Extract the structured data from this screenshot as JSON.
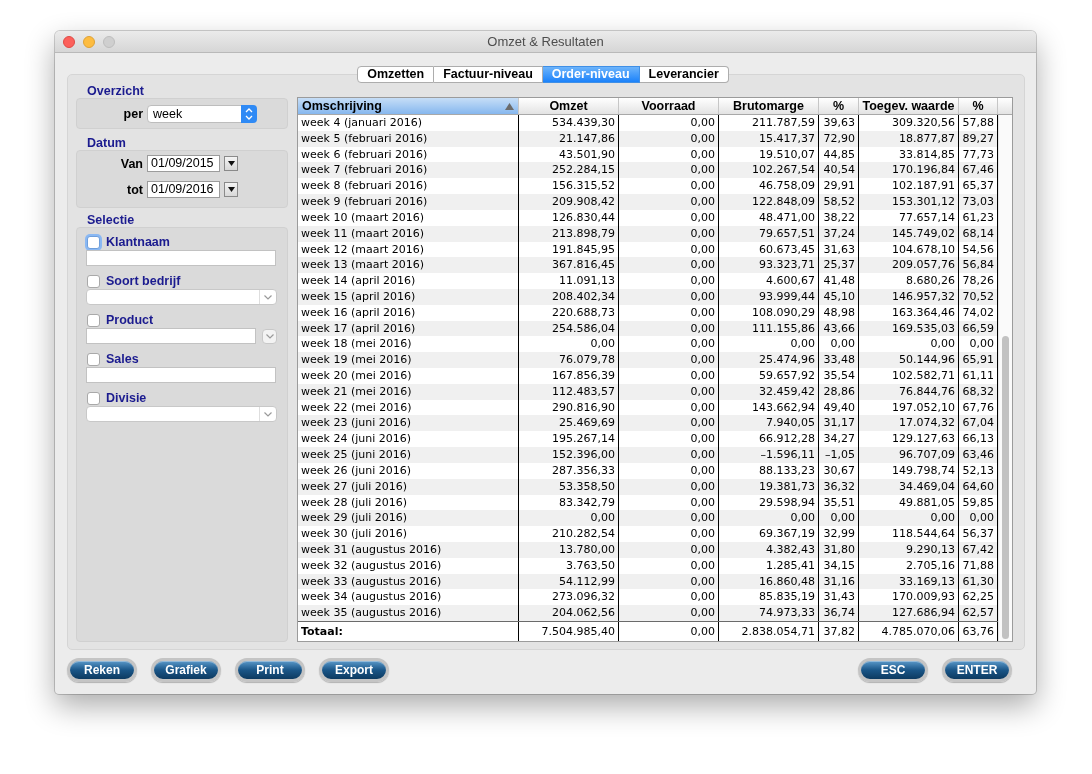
{
  "window": {
    "title": "Omzet & Resultaten"
  },
  "tabs": [
    {
      "label": "Omzetten",
      "selected": false
    },
    {
      "label": "Factuur-niveau",
      "selected": false
    },
    {
      "label": "Order-niveau",
      "selected": true
    },
    {
      "label": "Leverancier",
      "selected": false
    }
  ],
  "overzicht": {
    "title": "Overzicht",
    "per_label": "per",
    "per_value": "week"
  },
  "datum": {
    "title": "Datum",
    "fields": [
      {
        "label": "Van",
        "value": "01/09/2015"
      },
      {
        "label": "tot",
        "value": "01/09/2016"
      }
    ]
  },
  "selectie": {
    "title": "Selectie",
    "filters": [
      {
        "label": "Klantnaam",
        "kind": "text",
        "checked": false,
        "focused": true
      },
      {
        "label": "Soort bedrijf",
        "kind": "combo",
        "checked": false,
        "focused": false
      },
      {
        "label": "Product",
        "kind": "combo-split",
        "checked": false,
        "focused": false
      },
      {
        "label": "Sales",
        "kind": "text",
        "checked": false,
        "focused": false
      },
      {
        "label": "Divisie",
        "kind": "combo",
        "checked": false,
        "focused": false
      }
    ]
  },
  "table": {
    "columns": [
      {
        "label": "Omschrijving",
        "selected": true
      },
      {
        "label": "Omzet",
        "selected": false
      },
      {
        "label": "Voorraad",
        "selected": false
      },
      {
        "label": "Brutomarge",
        "selected": false
      },
      {
        "label": "%",
        "selected": false
      },
      {
        "label": "Toegev. waarde",
        "selected": false
      },
      {
        "label": "%",
        "selected": false
      }
    ],
    "rows": [
      [
        "week 4 (januari 2016)",
        "534.439,30",
        "0,00",
        "211.787,59",
        "39,63",
        "309.320,56",
        "57,88"
      ],
      [
        "week 5 (februari 2016)",
        "21.147,86",
        "0,00",
        "15.417,37",
        "72,90",
        "18.877,87",
        "89,27"
      ],
      [
        "week 6 (februari 2016)",
        "43.501,90",
        "0,00",
        "19.510,07",
        "44,85",
        "33.814,85",
        "77,73"
      ],
      [
        "week 7 (februari 2016)",
        "252.284,15",
        "0,00",
        "102.267,54",
        "40,54",
        "170.196,84",
        "67,46"
      ],
      [
        "week 8 (februari 2016)",
        "156.315,52",
        "0,00",
        "46.758,09",
        "29,91",
        "102.187,91",
        "65,37"
      ],
      [
        "week 9 (februari 2016)",
        "209.908,42",
        "0,00",
        "122.848,09",
        "58,52",
        "153.301,12",
        "73,03"
      ],
      [
        "week 10 (maart 2016)",
        "126.830,44",
        "0,00",
        "48.471,00",
        "38,22",
        "77.657,14",
        "61,23"
      ],
      [
        "week 11 (maart 2016)",
        "213.898,79",
        "0,00",
        "79.657,51",
        "37,24",
        "145.749,02",
        "68,14"
      ],
      [
        "week 12 (maart 2016)",
        "191.845,95",
        "0,00",
        "60.673,45",
        "31,63",
        "104.678,10",
        "54,56"
      ],
      [
        "week 13 (maart 2016)",
        "367.816,45",
        "0,00",
        "93.323,71",
        "25,37",
        "209.057,76",
        "56,84"
      ],
      [
        "week 14 (april 2016)",
        "11.091,13",
        "0,00",
        "4.600,67",
        "41,48",
        "8.680,26",
        "78,26"
      ],
      [
        "week 15 (april 2016)",
        "208.402,34",
        "0,00",
        "93.999,44",
        "45,10",
        "146.957,32",
        "70,52"
      ],
      [
        "week 16 (april 2016)",
        "220.688,73",
        "0,00",
        "108.090,29",
        "48,98",
        "163.364,46",
        "74,02"
      ],
      [
        "week 17 (april 2016)",
        "254.586,04",
        "0,00",
        "111.155,86",
        "43,66",
        "169.535,03",
        "66,59"
      ],
      [
        "week 18 (mei 2016)",
        "0,00",
        "0,00",
        "0,00",
        "0,00",
        "0,00",
        "0,00"
      ],
      [
        "week 19 (mei 2016)",
        "76.079,78",
        "0,00",
        "25.474,96",
        "33,48",
        "50.144,96",
        "65,91"
      ],
      [
        "week 20 (mei 2016)",
        "167.856,39",
        "0,00",
        "59.657,92",
        "35,54",
        "102.582,71",
        "61,11"
      ],
      [
        "week 21 (mei 2016)",
        "112.483,57",
        "0,00",
        "32.459,42",
        "28,86",
        "76.844,76",
        "68,32"
      ],
      [
        "week 22 (mei 2016)",
        "290.816,90",
        "0,00",
        "143.662,94",
        "49,40",
        "197.052,10",
        "67,76"
      ],
      [
        "week 23 (juni 2016)",
        "25.469,69",
        "0,00",
        "7.940,05",
        "31,17",
        "17.074,32",
        "67,04"
      ],
      [
        "week 24 (juni 2016)",
        "195.267,14",
        "0,00",
        "66.912,28",
        "34,27",
        "129.127,63",
        "66,13"
      ],
      [
        "week 25 (juni 2016)",
        "152.396,00",
        "0,00",
        "–1.596,11",
        "–1,05",
        "96.707,09",
        "63,46"
      ],
      [
        "week 26 (juni 2016)",
        "287.356,33",
        "0,00",
        "88.133,23",
        "30,67",
        "149.798,74",
        "52,13"
      ],
      [
        "week 27 (juli 2016)",
        "53.358,50",
        "0,00",
        "19.381,73",
        "36,32",
        "34.469,04",
        "64,60"
      ],
      [
        "week 28 (juli 2016)",
        "83.342,79",
        "0,00",
        "29.598,94",
        "35,51",
        "49.881,05",
        "59,85"
      ],
      [
        "week 29 (juli 2016)",
        "0,00",
        "0,00",
        "0,00",
        "0,00",
        "0,00",
        "0,00"
      ],
      [
        "week 30 (juli 2016)",
        "210.282,54",
        "0,00",
        "69.367,19",
        "32,99",
        "118.544,64",
        "56,37"
      ],
      [
        "week 31 (augustus 2016)",
        "13.780,00",
        "0,00",
        "4.382,43",
        "31,80",
        "9.290,13",
        "67,42"
      ],
      [
        "week 32 (augustus 2016)",
        "3.763,50",
        "0,00",
        "1.285,41",
        "34,15",
        "2.705,16",
        "71,88"
      ],
      [
        "week 33 (augustus 2016)",
        "54.112,99",
        "0,00",
        "16.860,48",
        "31,16",
        "33.169,13",
        "61,30"
      ],
      [
        "week 34 (augustus 2016)",
        "273.096,32",
        "0,00",
        "85.835,19",
        "31,43",
        "170.009,93",
        "62,25"
      ],
      [
        "week 35 (augustus 2016)",
        "204.062,56",
        "0,00",
        "74.973,33",
        "36,74",
        "127.686,94",
        "62,57"
      ]
    ],
    "total": [
      "Totaal:",
      "7.504.985,40",
      "0,00",
      "2.838.054,71",
      "37,82",
      "4.785.070,06",
      "63,76"
    ]
  },
  "footer": {
    "left_buttons": [
      "Reken",
      "Grafiek",
      "Print",
      "Export"
    ],
    "right_buttons": [
      "ESC",
      "ENTER"
    ]
  }
}
